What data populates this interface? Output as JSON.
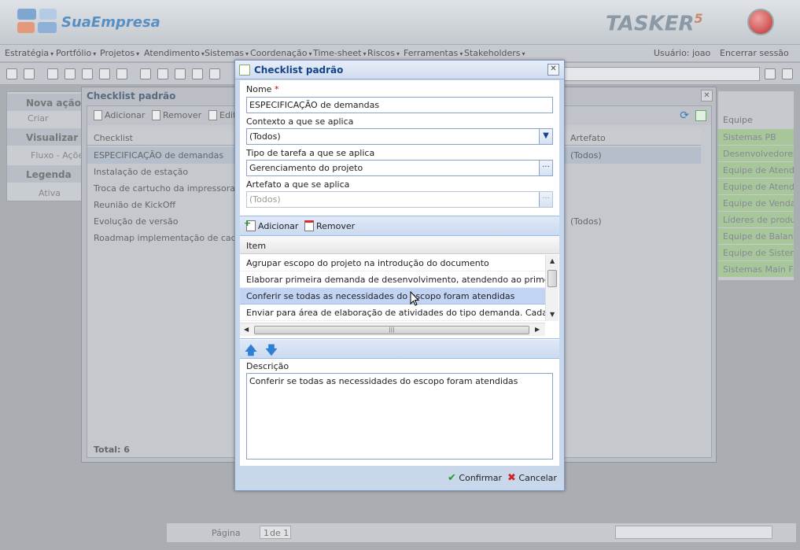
{
  "header": {
    "company": "SuaEmpresa",
    "app_name": "TASKER",
    "app_version": "5"
  },
  "menu": [
    "Estratégia",
    "Portfólio",
    "Projetos",
    "Atendimento",
    "Sistemas",
    "Coordenação",
    "Time-sheet",
    "Riscos",
    "Ferramentas",
    "Stakeholders"
  ],
  "user": {
    "label": "Usuário: joao",
    "logout": "Encerrar sessão"
  },
  "left_panel": {
    "new_action": "Nova ação p",
    "create": "Criar",
    "view": "Visualizar",
    "flow": "Fluxo - Açõe",
    "legend": "Legenda",
    "active": "Ativa"
  },
  "right_grid": {
    "header": "Equipe",
    "rows": [
      "Sistemas PB",
      "Desenvolvedores",
      "Equipe de Atendim",
      "Equipe de Atendim",
      "Equipe de Venda",
      "Líderes de produto",
      "Equipe de Balance",
      "Equipe de Sistema",
      "Sistemas Main Fra"
    ]
  },
  "bottom_pager": {
    "page_label": "Página",
    "page_value": "1",
    "of_label": "de 1"
  },
  "list_window": {
    "title": "Checklist padrão",
    "add": "Adicionar",
    "remove": "Remover",
    "edit": "Edita",
    "col_checklist": "Checklist",
    "col_artifact": "Artefato",
    "rows": [
      {
        "name": "ESPECIFICAÇÃO de demandas",
        "artifact": "(Todos)"
      },
      {
        "name": "Instalação de estação",
        "artifact": ""
      },
      {
        "name": "Troca de cartucho da impressora",
        "artifact": ""
      },
      {
        "name": "Reunião de KickOff",
        "artifact": ""
      },
      {
        "name": "Evolução de versão",
        "artifact": "(Todos)"
      },
      {
        "name": "Roadmap implementação de cadastro",
        "artifact": ""
      }
    ],
    "total": "Total: 6"
  },
  "dialog": {
    "title": "Checklist padrão",
    "name_label": "Nome",
    "required_mark": "*",
    "name_value": "ESPECIFICAÇÃO de demandas",
    "context_label": "Contexto a que se aplica",
    "context_value": "(Todos)",
    "task_type_label": "Tipo de tarefa a que se aplica",
    "task_type_value": "Gerenciamento do projeto",
    "artifact_label": "Artefato a que se aplica",
    "artifact_value": "(Todos)",
    "add": "Adicionar",
    "remove": "Remover",
    "items_header": "Item",
    "items": [
      "Agrupar escopo do projeto na introdução do documento",
      "Elaborar primeira demanda de desenvolvimento, atendendo ao primeiro esc...",
      "Conferir se todas as necessidades do escopo foram atendidas",
      "Enviar para área de elaboração de atividades do tipo demanda. Cada dema..."
    ],
    "description_label": "Descrição",
    "description_value": "Conferir se todas as necessidades do escopo foram atendidas",
    "confirm": "Confirmar",
    "cancel": "Cancelar"
  }
}
